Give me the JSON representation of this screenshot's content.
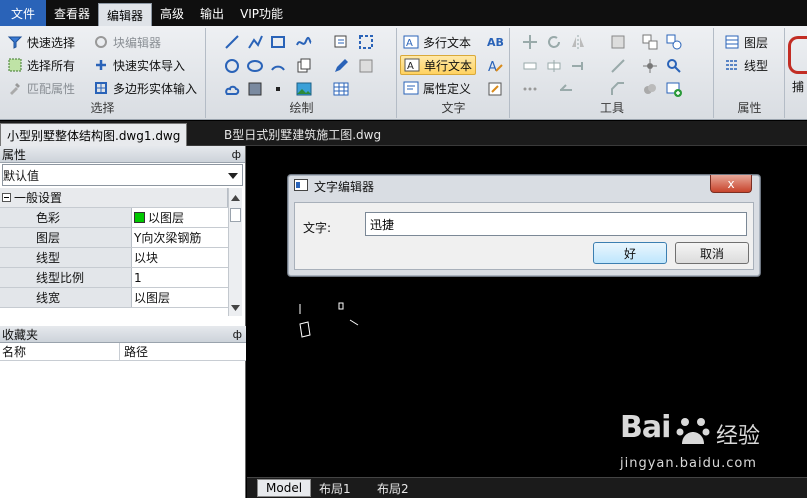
{
  "menubar": {
    "items": [
      "文件",
      "查看器",
      "编辑器",
      "高级",
      "输出",
      "VIP功能"
    ]
  },
  "ribbon": {
    "select": {
      "label": "选择",
      "quick_select": "快速选择",
      "block_editor": "块编辑器",
      "select_all": "选择所有",
      "quick_import": "快速实体导入",
      "match_props": "匹配属性",
      "polygon_input": "多边形实体输入"
    },
    "draw": {
      "label": "绘制"
    },
    "text": {
      "label": "文字",
      "mtext": "多行文本",
      "stext": "单行文本",
      "attdef": "属性定义"
    },
    "tools": {
      "label": "工具"
    },
    "props": {
      "label": "属性",
      "layer": "图层",
      "linetype": "线型"
    },
    "cut": "捕"
  },
  "doc_tabs": [
    "小型别墅整体结构图.dwg1.dwg",
    "B型日式别墅建筑施工图.dwg"
  ],
  "properties_panel": {
    "title": "属性",
    "pin": "ф",
    "combo_value": "默认值",
    "category": "一般设置",
    "rows": [
      {
        "key": "色彩",
        "value": "以图层"
      },
      {
        "key": "图层",
        "value": "Y向次梁钢筋"
      },
      {
        "key": "线型",
        "value": "以块"
      },
      {
        "key": "线型比例",
        "value": "1"
      },
      {
        "key": "线宽",
        "value": "以图层"
      }
    ]
  },
  "favorites_panel": {
    "title": "收藏夹",
    "pin": "ф",
    "col_name": "名称",
    "col_path": "路径"
  },
  "layout_tabs": [
    "Model",
    "布局1",
    "布局2"
  ],
  "dialog": {
    "title": "文字编辑器",
    "close": "x",
    "label": "文字:",
    "value": "迅捷",
    "ok": "好",
    "cancel": "取消"
  },
  "watermark": {
    "brand": "Bai",
    "brand2": "经验",
    "url": "jingyan.baidu.com"
  },
  "colors": {
    "accent": "#2a63b8",
    "color_swatch": "#00c800",
    "highlight": "#ffd260"
  }
}
